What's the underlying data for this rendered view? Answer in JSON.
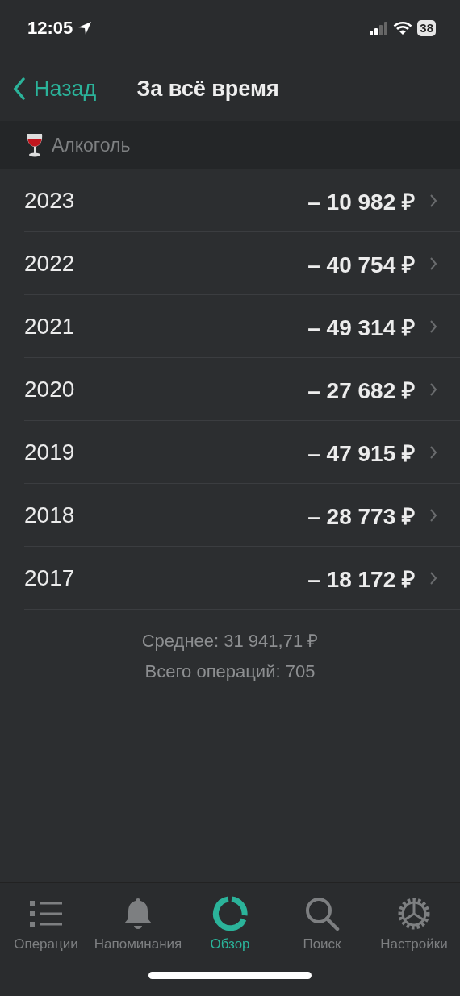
{
  "status_bar": {
    "time": "12:05",
    "battery": "38"
  },
  "nav": {
    "back": "Назад",
    "title": "За всё время"
  },
  "category": {
    "label": "Алкоголь"
  },
  "years": [
    {
      "year": "2023",
      "amount": "– 10 982 ₽"
    },
    {
      "year": "2022",
      "amount": "– 40 754 ₽"
    },
    {
      "year": "2021",
      "amount": "– 49 314 ₽"
    },
    {
      "year": "2020",
      "amount": "– 27 682 ₽"
    },
    {
      "year": "2019",
      "amount": "– 47 915 ₽"
    },
    {
      "year": "2018",
      "amount": "– 28 773 ₽"
    },
    {
      "year": "2017",
      "amount": "– 18 172 ₽"
    }
  ],
  "summary": {
    "average": "Среднее: 31 941,71 ₽",
    "count": "Всего операций: 705"
  },
  "tabs": [
    {
      "label": "Операции",
      "selected": false
    },
    {
      "label": "Напоминания",
      "selected": false
    },
    {
      "label": "Обзор",
      "selected": true
    },
    {
      "label": "Поиск",
      "selected": false
    },
    {
      "label": "Настройки",
      "selected": false
    }
  ]
}
